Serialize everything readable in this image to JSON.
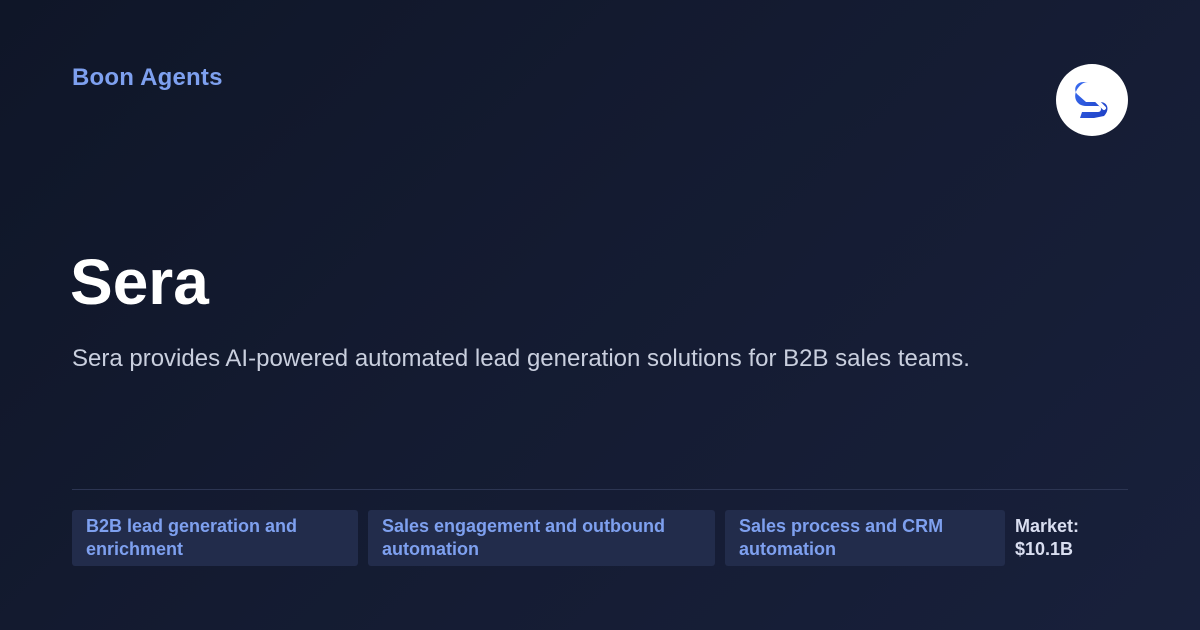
{
  "brand": {
    "name": "Boon Agents"
  },
  "logo": {
    "icon": "sera-s-logo-icon",
    "accent": "#2d5be3"
  },
  "company": {
    "name": "Sera",
    "description": "Sera provides AI-powered automated lead generation solutions for B2B sales teams."
  },
  "tags": [
    {
      "label": "B2B lead generation and enrichment"
    },
    {
      "label": "Sales engagement and outbound automation"
    },
    {
      "label": "Sales process and CRM automation"
    }
  ],
  "market": {
    "label": "Market:",
    "value": "$10.1B"
  },
  "colors": {
    "background": "#141b31",
    "brand_text": "#7ea0ef",
    "tag_background": "#222c4b"
  }
}
